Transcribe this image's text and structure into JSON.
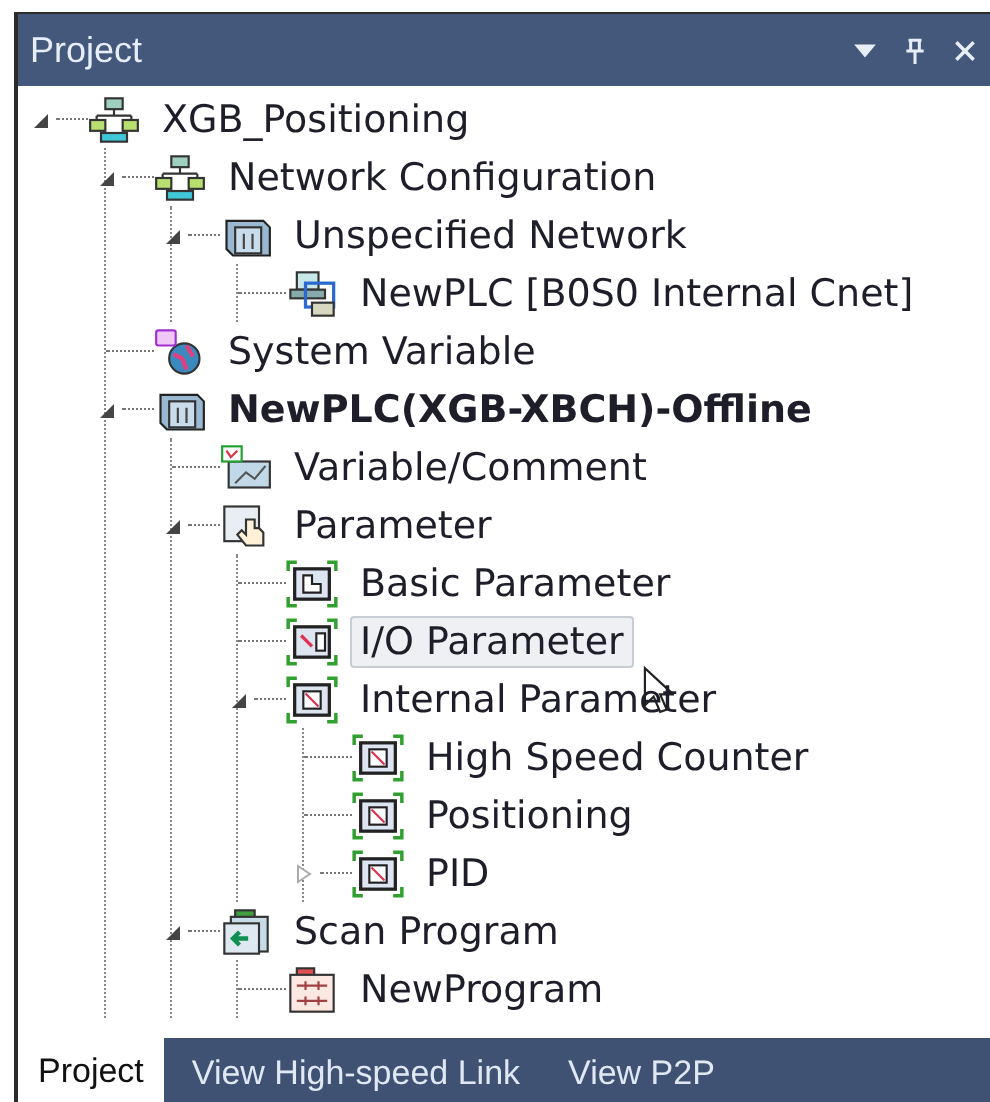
{
  "panel": {
    "title": "Project"
  },
  "tree": [
    {
      "label": "XGB_Positioning",
      "kind": "project",
      "bold": false,
      "selected": false,
      "expanded": true,
      "children": [
        {
          "label": "Network Configuration",
          "kind": "project",
          "bold": false,
          "selected": false,
          "expanded": true,
          "children": [
            {
              "label": "Unspecified Network",
              "kind": "network",
              "bold": false,
              "selected": false,
              "expanded": true,
              "children": [
                {
                  "label": "NewPLC [B0S0 Internal Cnet]",
                  "kind": "station",
                  "bold": false,
                  "selected": false
                }
              ]
            }
          ]
        },
        {
          "label": "System Variable",
          "kind": "system",
          "bold": false,
          "selected": false
        },
        {
          "label": "NewPLC(XGB-XBCH)-Offline",
          "kind": "network",
          "bold": true,
          "selected": false,
          "expanded": true,
          "children": [
            {
              "label": "Variable/Comment",
              "kind": "variable",
              "bold": false,
              "selected": false
            },
            {
              "label": "Parameter",
              "kind": "parameter",
              "bold": false,
              "selected": false,
              "expanded": true,
              "children": [
                {
                  "label": "Basic Parameter",
                  "kind": "basic",
                  "bold": false,
                  "selected": false
                },
                {
                  "label": "I/O Parameter",
                  "kind": "io",
                  "bold": false,
                  "selected": true
                },
                {
                  "label": "Internal Parameter",
                  "kind": "internal",
                  "bold": false,
                  "selected": false,
                  "expanded": true,
                  "children": [
                    {
                      "label": "High Speed Counter",
                      "kind": "internal",
                      "bold": false,
                      "selected": false
                    },
                    {
                      "label": "Positioning",
                      "kind": "internal",
                      "bold": false,
                      "selected": false
                    },
                    {
                      "label": "PID",
                      "kind": "internal",
                      "bold": false,
                      "selected": false,
                      "expanded": false
                    }
                  ]
                }
              ]
            },
            {
              "label": "Scan Program",
              "kind": "scan",
              "bold": false,
              "selected": false,
              "expanded": true,
              "children": [
                {
                  "label": "NewProgram",
                  "kind": "program",
                  "bold": false,
                  "selected": false
                }
              ]
            }
          ]
        }
      ]
    }
  ],
  "tabs": [
    {
      "label": "Project",
      "selected": true
    },
    {
      "label": "View High-speed Link",
      "selected": false
    },
    {
      "label": "View P2P",
      "selected": false
    }
  ]
}
